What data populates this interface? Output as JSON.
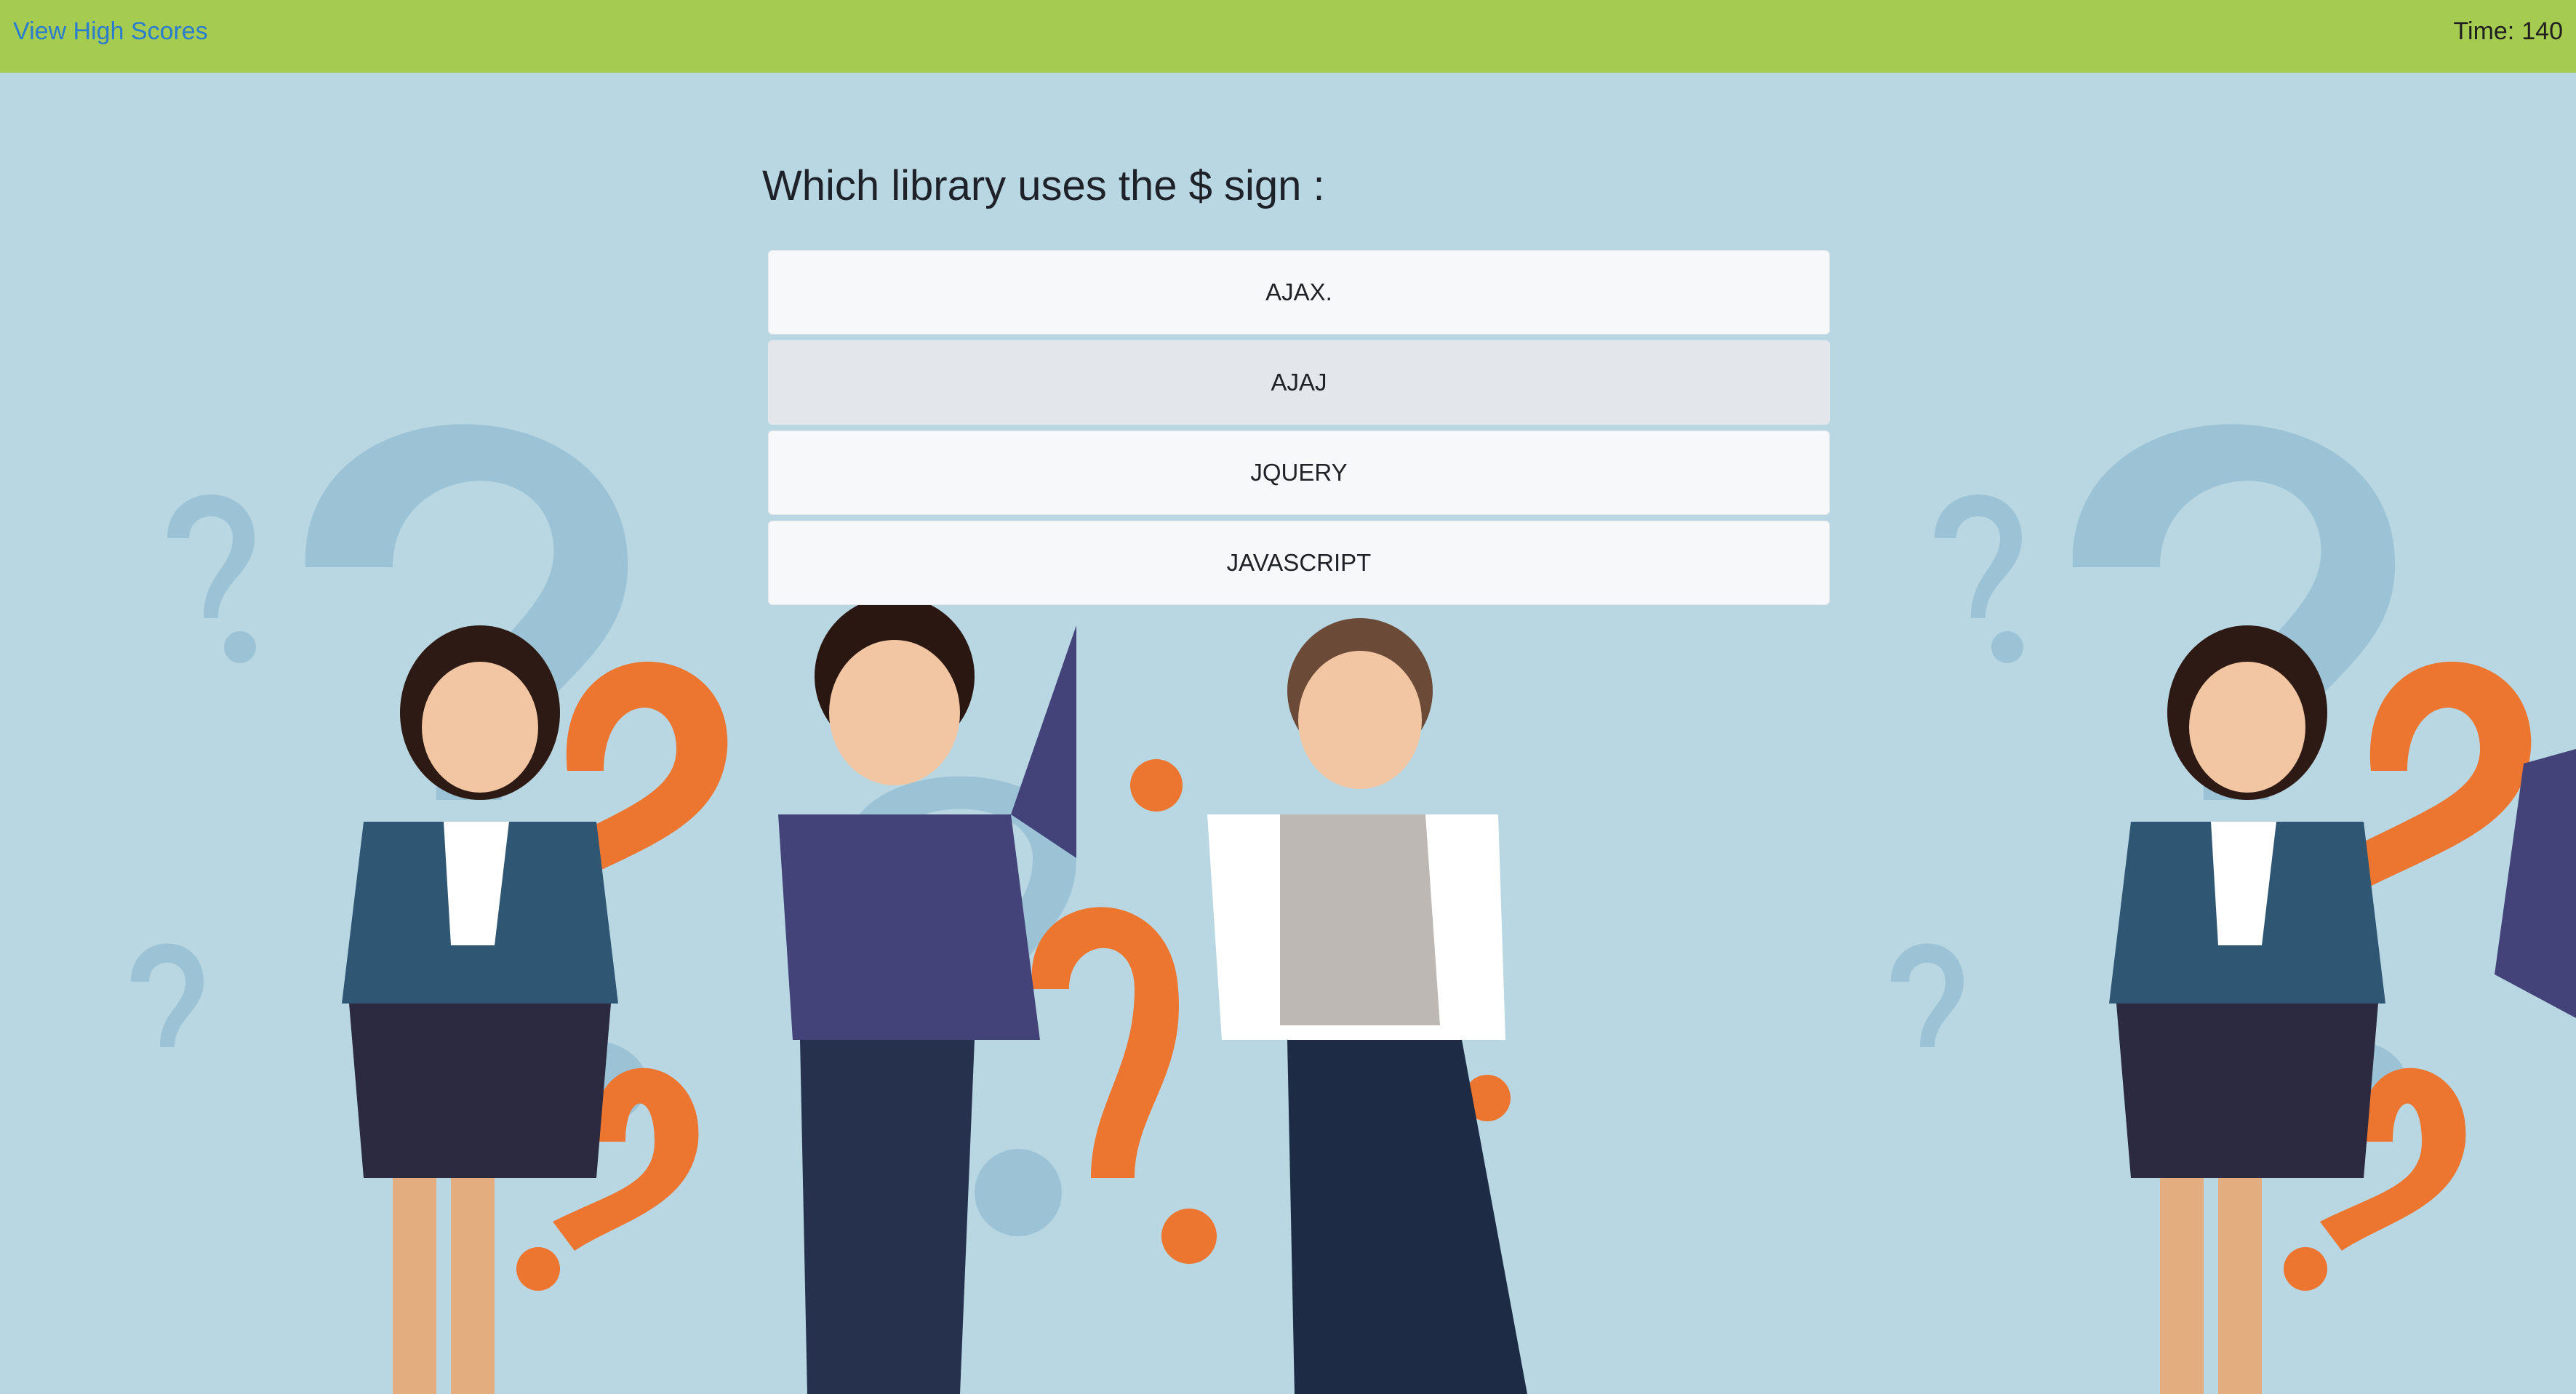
{
  "header": {
    "high_scores_link": "View High Scores",
    "timer_label": "Time:",
    "timer_value": "140"
  },
  "quiz": {
    "question": "Which library uses the $ sign :",
    "answers": [
      {
        "label": "AJAX."
      },
      {
        "label": "AJAJ"
      },
      {
        "label": "JQUERY"
      },
      {
        "label": "JAVASCRIPT"
      }
    ]
  },
  "colors": {
    "header_bg": "#a5cb50",
    "link": "#2a7ccf",
    "page_bg": "#b8d7e2",
    "answer_bg": "#f7f8fa",
    "answer_hover_bg": "#e3e6ea"
  }
}
